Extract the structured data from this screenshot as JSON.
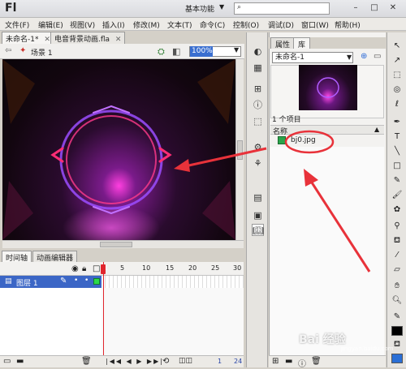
{
  "titlebar": {
    "logo": "Fl",
    "workspace": "基本功能",
    "workspace_arrow": "▼",
    "search_icon": "search-icon",
    "minimize": "–",
    "restore": "□",
    "close": "✕"
  },
  "menubar": {
    "items": [
      "文件(F)",
      "编辑(E)",
      "视图(V)",
      "插入(I)",
      "修改(M)",
      "文本(T)",
      "命令(C)",
      "控制(O)",
      "调试(D)",
      "窗口(W)",
      "帮助(H)"
    ]
  },
  "doctabs": {
    "tab1": "未命名-1*",
    "tab1_close": "✕",
    "tab2": "电音背景动画.fla",
    "tab2_close": "✕"
  },
  "scene": {
    "label": "场景 1",
    "zoom": "100%"
  },
  "timeline": {
    "tab_timeline": "时间轴",
    "tab_motion": "动画编辑器",
    "frame_numbers": [
      "1",
      "5",
      "10",
      "15",
      "20",
      "25",
      "30"
    ],
    "layer_name": "图层 1",
    "footer_frame": "1",
    "footer_fps": "24"
  },
  "library": {
    "tab_properties": "属性",
    "tab_library": "库",
    "document": "未命名-1",
    "item_count": "1 个项目",
    "name_header": "名称",
    "item_name": "bj0.jpg"
  },
  "watermark": {
    "text": "Bai 经验",
    "sub": "jingyan.baidu.com"
  },
  "colors": {
    "accent": "#3b66c6",
    "annotation": "#e8323a",
    "playhead": "#e0262e"
  }
}
